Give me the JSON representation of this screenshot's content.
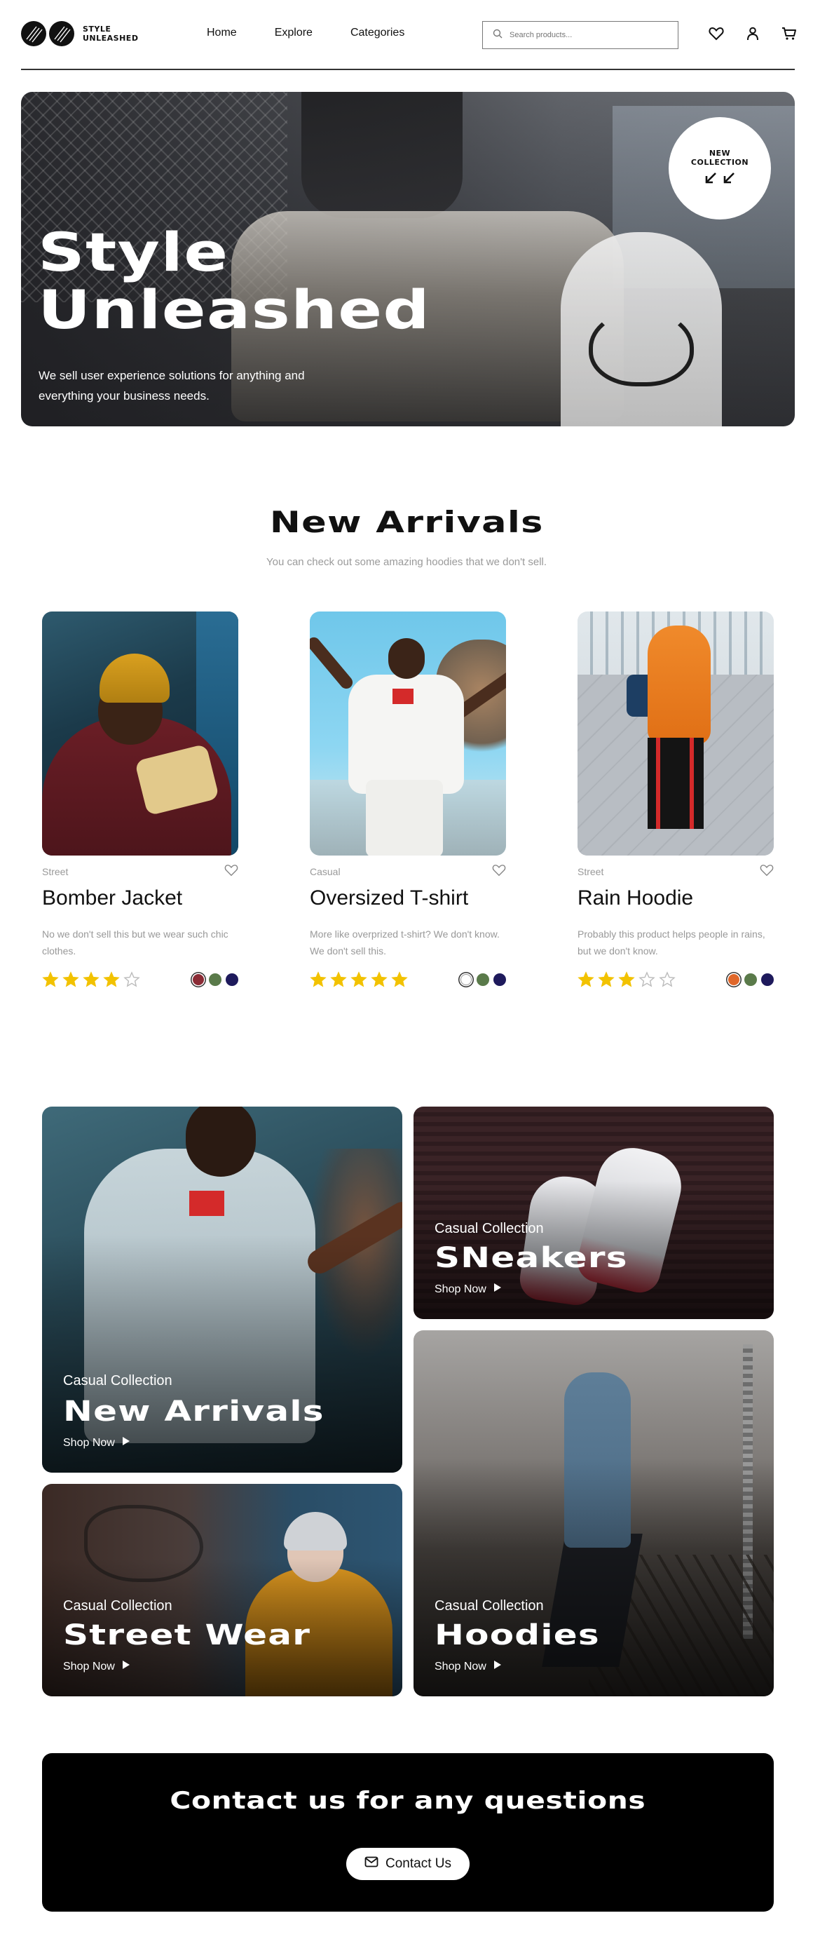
{
  "brand": {
    "name_line1": "STYLE",
    "name_line2": "UNLEASHED"
  },
  "nav": {
    "items": [
      "Home",
      "Explore",
      "Categories"
    ]
  },
  "search": {
    "placeholder": "Search products..."
  },
  "header_icons": [
    "heart-icon",
    "user-icon",
    "cart-icon"
  ],
  "hero": {
    "title_line1": "Style",
    "title_line2": "Unleashed",
    "subtitle": "We sell user experience solutions for anything and everything your business needs.",
    "badge_line1": "NEW",
    "badge_line2": "COLLECTION"
  },
  "new_arrivals": {
    "title": "New Arrivals",
    "subtitle": "You can check out some amazing hoodies that we don't sell.",
    "products": [
      {
        "category": "Street",
        "name": "Bomber Jacket",
        "description": "No we don't sell this but we wear such chic clothes.",
        "rating": 4,
        "rating_max": 5,
        "swatches": [
          "#8b2b35",
          "#5a7a4a",
          "#1e1a5c"
        ],
        "selected_swatch": 0
      },
      {
        "category": "Casual",
        "name": "Oversized T-shirt",
        "description": "More like overprized t-shirt? We don't know. We don't sell this.",
        "rating": 5,
        "rating_max": 5,
        "swatches": [
          "#ffffff",
          "#5a7a4a",
          "#1e1a5c"
        ],
        "selected_swatch": 0
      },
      {
        "category": "Street",
        "name": "Rain Hoodie",
        "description": "Probably this product helps people in rains, but we don't know.",
        "rating": 3,
        "rating_max": 5,
        "swatches": [
          "#e0672a",
          "#5a7a4a",
          "#1e1a5c"
        ],
        "selected_swatch": 0
      }
    ]
  },
  "collections": [
    {
      "label": "Casual Collection",
      "title": "New Arrivals",
      "cta": "Shop Now"
    },
    {
      "label": "Casual Collection",
      "title": "SNeakers",
      "cta": "Shop Now"
    },
    {
      "label": "Casual Collection",
      "title": "Street Wear",
      "cta": "Shop Now"
    },
    {
      "label": "Casual Collection",
      "title": "Hoodies",
      "cta": "Shop Now"
    }
  ],
  "contact": {
    "title": "Contact us for any questions",
    "button": "Contact Us"
  },
  "colors": {
    "star": "#f2c200",
    "star_empty": "#bbbbbb",
    "ink": "#111111"
  }
}
